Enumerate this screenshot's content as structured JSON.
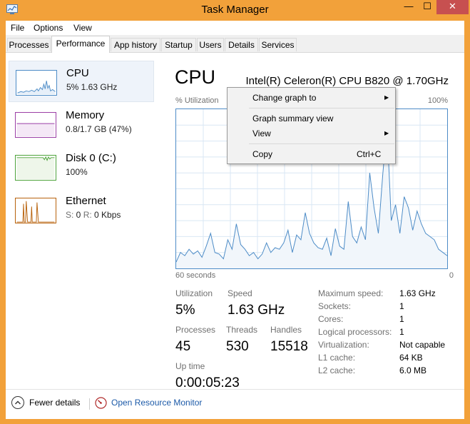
{
  "window": {
    "title": "Task Manager",
    "minimize": "—",
    "maximize": "☐",
    "close": "✕"
  },
  "menubar": {
    "file": "File",
    "options": "Options",
    "view": "View"
  },
  "tabs": [
    "Processes",
    "Performance",
    "App history",
    "Startup",
    "Users",
    "Details",
    "Services"
  ],
  "sidebar": [
    {
      "name": "CPU",
      "sub": "5% 1.63 GHz"
    },
    {
      "name": "Memory",
      "sub": "0.8/1.7 GB (47%)"
    },
    {
      "name": "Disk 0 (C:)",
      "sub": "100%"
    },
    {
      "name": "Ethernet",
      "sub_parts": [
        "S: ",
        "0",
        " R: ",
        "0 Kbps"
      ]
    }
  ],
  "cpu_panel": {
    "title": "CPU",
    "model": "Intel(R) Celeron(R) CPU B820 @ 1.70GHz",
    "graph": {
      "y_label": "% Utilization",
      "y_max_label": "100%",
      "x_left_label": "60 seconds",
      "x_right_label": "0",
      "samples": [
        4,
        10,
        8,
        12,
        9,
        11,
        7,
        14,
        22,
        10,
        9,
        6,
        18,
        12,
        28,
        15,
        12,
        8,
        10,
        6,
        9,
        16,
        10,
        13,
        12,
        16,
        24,
        10,
        21,
        18,
        35,
        22,
        16,
        13,
        12,
        19,
        8,
        25,
        14,
        12,
        42,
        20,
        16,
        26,
        18,
        60,
        38,
        22,
        58,
        90,
        30,
        40,
        22,
        45,
        38,
        24,
        36,
        28,
        22,
        20,
        18,
        12,
        10,
        8
      ],
      "colors": {
        "line": "#4d8cc7",
        "fill": "#f1f6fb",
        "grid": "#d9e7f4"
      }
    },
    "stats": {
      "utilization": {
        "label": "Utilization",
        "value": "5%"
      },
      "speed": {
        "label": "Speed",
        "value": "1.63 GHz"
      },
      "processes": {
        "label": "Processes",
        "value": "45"
      },
      "threads": {
        "label": "Threads",
        "value": "530"
      },
      "handles": {
        "label": "Handles",
        "value": "15518"
      },
      "uptime": {
        "label": "Up time",
        "value": "0:00:05:23"
      }
    },
    "specs": [
      {
        "label": "Maximum speed:",
        "value": "1.63 GHz"
      },
      {
        "label": "Sockets:",
        "value": "1"
      },
      {
        "label": "Cores:",
        "value": "1"
      },
      {
        "label": "Logical processors:",
        "value": "1"
      },
      {
        "label": "Virtualization:",
        "value": "Not capable"
      },
      {
        "label": "L1 cache:",
        "value": "64 KB"
      },
      {
        "label": "L2 cache:",
        "value": "6.0 MB"
      }
    ]
  },
  "context_menu": {
    "items": [
      {
        "label": "Change graph to",
        "submenu": true
      },
      {
        "label": "Graph summary view"
      },
      {
        "label": "View",
        "submenu": true
      },
      {
        "label": "Copy",
        "shortcut": "Ctrl+C"
      }
    ]
  },
  "footer": {
    "fewer_details": "Fewer details",
    "open_resource_monitor": "Open Resource Monitor"
  }
}
